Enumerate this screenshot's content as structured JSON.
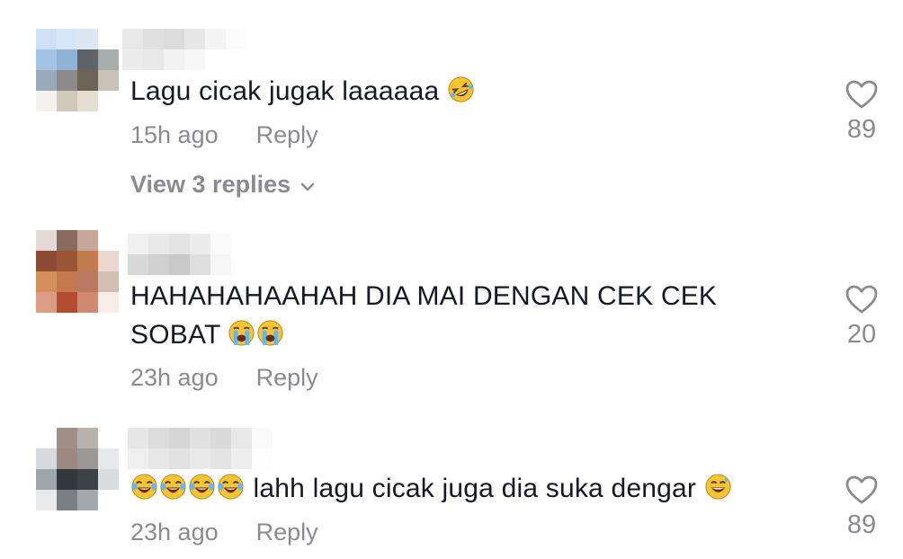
{
  "comments": [
    {
      "text_before": "Lagu cicak jugak laaaaaa",
      "emoji_after": [
        "rolling-on-floor-laughing"
      ],
      "time": "15h ago",
      "reply_label": "Reply",
      "likes": "89",
      "view_replies": "View 3 replies",
      "avatar_colors": [
        "#cfe0f5",
        "#d7e6f8",
        "#dce7f2",
        "#ffffff",
        "#a4c4e6",
        "#8fb2d8",
        "#5f6468",
        "#a9acac",
        "#9aaabb",
        "#8f8a88",
        "#6b6456",
        "#c6c2b8",
        "#f3f2ef",
        "#cfc8bb",
        "#e6ded0",
        "#ffffff"
      ],
      "username_colors": [
        "#e8e8e8",
        "#e0e0e0",
        "#dcdcdc",
        "#e6e6e6",
        "#f4f4f4",
        "#fcfcfc",
        "#ffffff",
        "#ffffff",
        "#ececec",
        "#e9e9e9",
        "#f2f2f2",
        "#f7f7f7",
        "#ffffff",
        "#ffffff",
        "#ffffff",
        "#ffffff"
      ]
    },
    {
      "text_before": "HAHAHAHAAHAH DIA MAI DENGAN CEK CEK SOBAT",
      "emoji_after": [
        "loudly-crying",
        "loudly-crying"
      ],
      "time": "23h ago",
      "reply_label": "Reply",
      "likes": "20",
      "avatar_colors": [
        "#e3d9d6",
        "#8a6a5c",
        "#c7a79a",
        "#ffffff",
        "#8d4b35",
        "#9a5534",
        "#c27b4c",
        "#ebd7cf",
        "#d4905a",
        "#c5774d",
        "#b87a61",
        "#d4beb4",
        "#dc9c85",
        "#b44b30",
        "#d08a70",
        "#f6ece8"
      ],
      "username_colors": [
        "#f0f0f0",
        "#e8e8e8",
        "#e4e4e4",
        "#ececec",
        "#fafafa",
        "#ffffff",
        "#ffffff",
        "#ffffff",
        "#d8d8d8",
        "#d0d0d0",
        "#c9c9c9",
        "#dedede",
        "#f6f6f6",
        "#ffffff",
        "#ffffff",
        "#ffffff"
      ]
    },
    {
      "emoji_before": [
        "face-with-tears-of-joy",
        "face-with-tears-of-joy",
        "face-with-tears-of-joy",
        "face-with-tears-of-joy"
      ],
      "text_before": " lahh lagu cicak juga dia suka dengar",
      "emoji_after": [
        "grinning-with-sweat"
      ],
      "time": "23h ago",
      "reply_label": "Reply",
      "likes": "89",
      "avatar_colors": [
        "#ffffff",
        "#a08f86",
        "#b7b2ad",
        "#ffffff",
        "#d7dbdd",
        "#9c8a82",
        "#9c9895",
        "#e6e8e9",
        "#a0a7ab",
        "#32373b",
        "#3d4246",
        "#d8dcdf",
        "#e9eaeb",
        "#7b7f83",
        "#a5a8ab",
        "#ffffff"
      ],
      "username_colors": [
        "#e6e6e6",
        "#dcdcdc",
        "#d6d6d6",
        "#e0e0e0",
        "#dadada",
        "#e8e8e8",
        "#fafafa",
        "#ffffff",
        "#efefef",
        "#e7e7e7",
        "#e2e2e2",
        "#e9e9e9",
        "#e4e4e4",
        "#eeeeee",
        "#fdfdfd",
        "#ffffff"
      ]
    }
  ],
  "colors": {
    "text": "#161823",
    "secondary": "#8a8b91",
    "background": "#ffffff"
  }
}
